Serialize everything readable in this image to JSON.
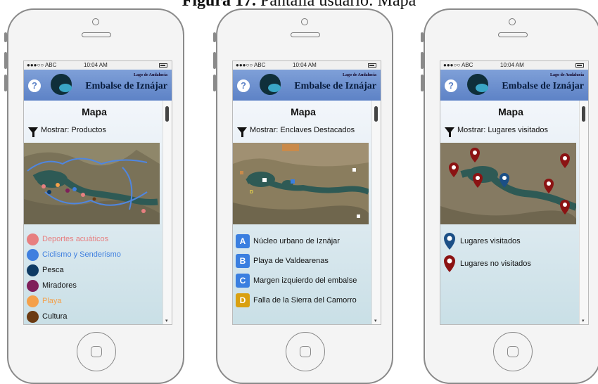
{
  "figure": {
    "title_bold": "Figura 17.",
    "title_rest": " Pantalla usuario: Mapa"
  },
  "status_bar": {
    "carrier": "●●●○○ ABC",
    "time": "10:04 AM"
  },
  "app": {
    "brand_small": "Lago de Andalucía",
    "brand": "Embalse de Iznájar",
    "help_label": "?",
    "page_title": "Mapa"
  },
  "screens": [
    {
      "filter": "Mostrar: Productos",
      "legend": [
        {
          "label": "Deportes acuáticos",
          "color": "#e77f80"
        },
        {
          "label": "Ciclismo y Senderismo",
          "color": "#3f7fdf"
        },
        {
          "label": "Pesca",
          "color": "#0e3a63"
        },
        {
          "label": "Miradores",
          "color": "#7f1f5a"
        },
        {
          "label": "Playa",
          "color": "#f4a04a"
        },
        {
          "label": "Cultura",
          "color": "#6b3a12"
        }
      ]
    },
    {
      "filter": "Mostrar: Enclaves Destacados",
      "enclaves": [
        {
          "letter": "A",
          "label": "Núcleo urbano de Iznájar",
          "color": "#3a7fe0"
        },
        {
          "letter": "B",
          "label": "Playa de Valdearenas",
          "color": "#3a7fe0"
        },
        {
          "letter": "C",
          "label": "Margen izquierdo del embalse",
          "color": "#3a7fe0"
        },
        {
          "letter": "D",
          "label": "Falla de la Sierra del Camorro",
          "color": "#d9a011"
        }
      ]
    },
    {
      "filter": "Mostrar: Lugares visitados",
      "places": [
        {
          "label": "Lugares visitados",
          "color": "#1b4f86"
        },
        {
          "label": "Lugares no visitados",
          "color": "#8b1313"
        }
      ]
    }
  ],
  "icons": {
    "filter": "funnel-icon",
    "help": "help-icon",
    "pin": "map-pin-icon"
  }
}
